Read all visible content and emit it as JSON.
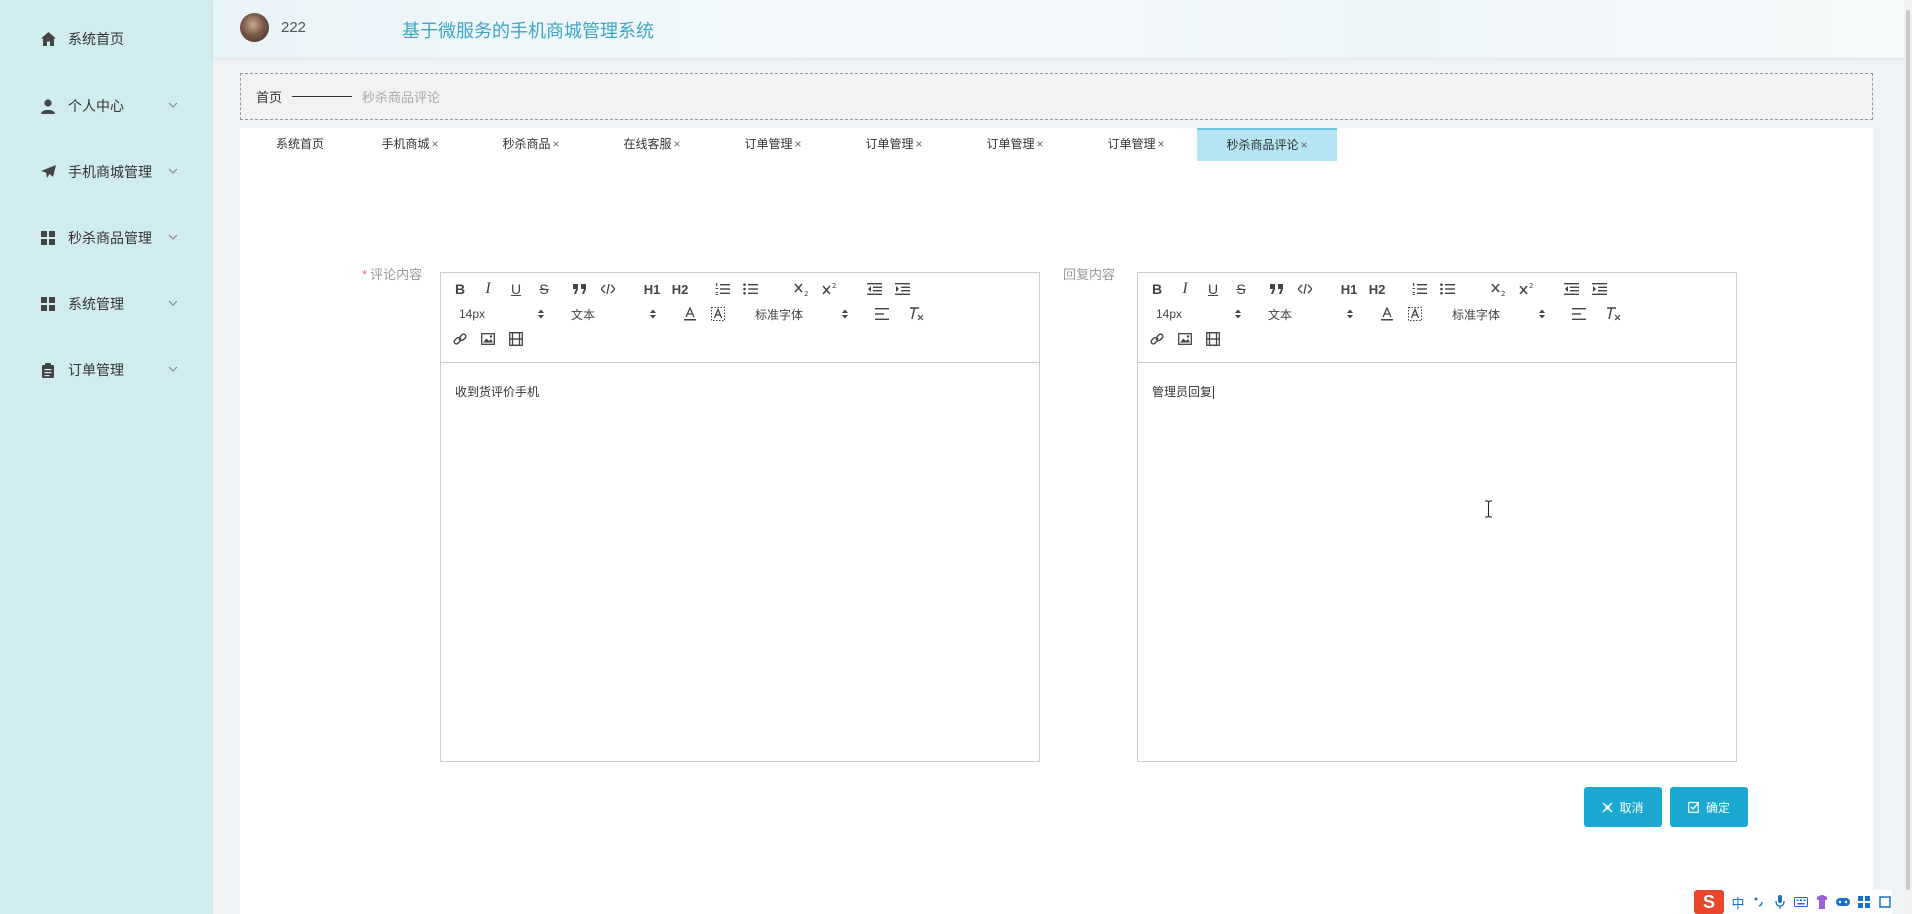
{
  "header": {
    "username": "222",
    "app_title": "基于微服务的手机商城管理系统"
  },
  "sidebar": {
    "items": [
      {
        "label": "系统首页",
        "icon": "home-icon",
        "has_submenu": false
      },
      {
        "label": "个人中心",
        "icon": "user-icon",
        "has_submenu": true
      },
      {
        "label": "手机商城管理",
        "icon": "send-icon",
        "has_submenu": true
      },
      {
        "label": "秒杀商品管理",
        "icon": "grid-icon",
        "has_submenu": true
      },
      {
        "label": "系统管理",
        "icon": "grid-icon",
        "has_submenu": true
      },
      {
        "label": "订单管理",
        "icon": "clipboard-icon",
        "has_submenu": true
      }
    ]
  },
  "breadcrumb": {
    "home": "首页",
    "current": "秒杀商品评论"
  },
  "tabs": [
    {
      "label": "系统首页",
      "closable": false,
      "active": false
    },
    {
      "label": "手机商城",
      "closable": true,
      "active": false
    },
    {
      "label": "秒杀商品",
      "closable": true,
      "active": false
    },
    {
      "label": "在线客服",
      "closable": true,
      "active": false
    },
    {
      "label": "订单管理",
      "closable": true,
      "active": false
    },
    {
      "label": "订单管理",
      "closable": true,
      "active": false
    },
    {
      "label": "订单管理",
      "closable": true,
      "active": false
    },
    {
      "label": "订单管理",
      "closable": true,
      "active": false
    },
    {
      "label": "秒杀商品评论",
      "closable": true,
      "active": true
    }
  ],
  "tab_close_glyph": "×",
  "form": {
    "comment_label": "评论内容",
    "required_mark": "*",
    "reply_label": "回复内容",
    "comment_content": "收到货评价手机",
    "reply_content": "管理员回复",
    "toolbar": {
      "bold": "B",
      "italic": "I",
      "underline": "U",
      "strike": "S",
      "h1": "H1",
      "h2": "H2",
      "size_value": "14px",
      "header_value": "文本",
      "font_value": "标准字体"
    },
    "cancel_label": "取消",
    "confirm_label": "确定"
  },
  "colors": {
    "sidebar_bg": "#d1ecf1",
    "accent": "#1ba9d2",
    "title": "#3ea6c4",
    "active_tab": "#b5e4f2"
  },
  "tray": {
    "ime_logo": "S",
    "ime_mode": "中"
  }
}
